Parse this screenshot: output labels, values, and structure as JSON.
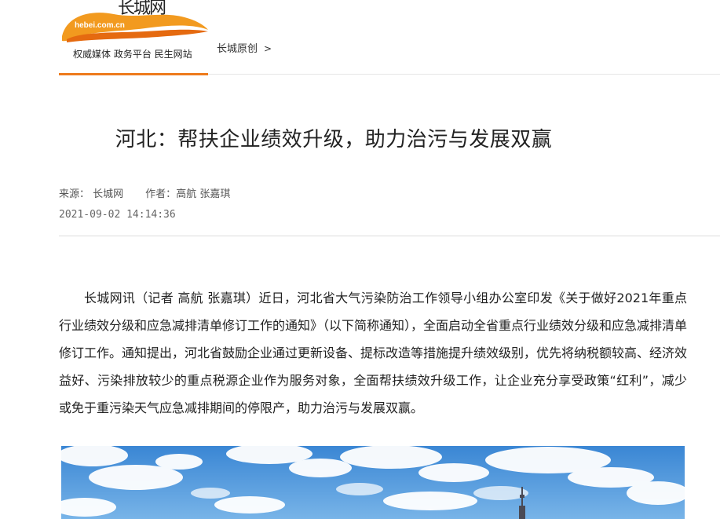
{
  "header": {
    "logo_domain": "hebei.com.cn",
    "logo_name": "长城网",
    "slogan": "权威媒体 政务平台 民生网站",
    "breadcrumb_label": "长城原创",
    "breadcrumb_sep": ">"
  },
  "article": {
    "title": "河北：帮扶企业绩效升级，助力治污与发展双赢",
    "source_label": "来源：",
    "source": "长城网",
    "author_label": "作者：",
    "authors": "高航 张嘉琪",
    "datetime": "2021-09-02 14:14:36",
    "body": "长城网讯（记者 高航 张嘉琪）近日，河北省大气污染防治工作领导小组办公室印发《关于做好2021年重点行业绩效分级和应急减排清单修订工作的通知》（以下简称通知），全面启动全省重点行业绩效分级和应急减排清单修订工作。通知提出，河北省鼓励企业通过更新设备、提标改造等措施提升绩效级别，优先将纳税额较高、经济效益好、污染排放较少的重点税源企业作为服务对象，全面帮扶绩效升级工作，让企业充分享受政策“红利”，减少或免于重污染天气应急减排期间的停限产，助力治污与发展双赢。"
  },
  "colors": {
    "accent": "#ee7b1c",
    "sky": "#3f8fd8"
  }
}
